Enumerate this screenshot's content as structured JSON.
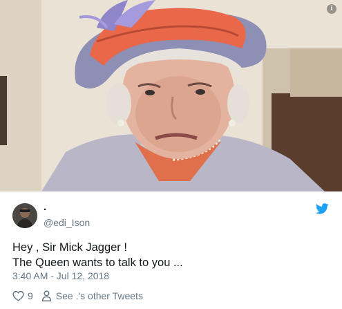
{
  "media": {
    "alt_icon": "info-icon"
  },
  "tweet": {
    "name": ".",
    "handle": "@edi_Ison",
    "text_lines": [
      "Hey , Sir Mick Jagger !",
      "The Queen wants to talk to you ..."
    ],
    "timestamp": "3:40 AM - Jul 12, 2018",
    "like_count": "9",
    "other_tweets_label": "See .'s other Tweets",
    "brand_color": "#1da1f2",
    "secondary_text_color": "#657786",
    "icons": {
      "like": "heart-icon",
      "profile": "person-icon",
      "brand": "twitter-bird-icon"
    }
  }
}
